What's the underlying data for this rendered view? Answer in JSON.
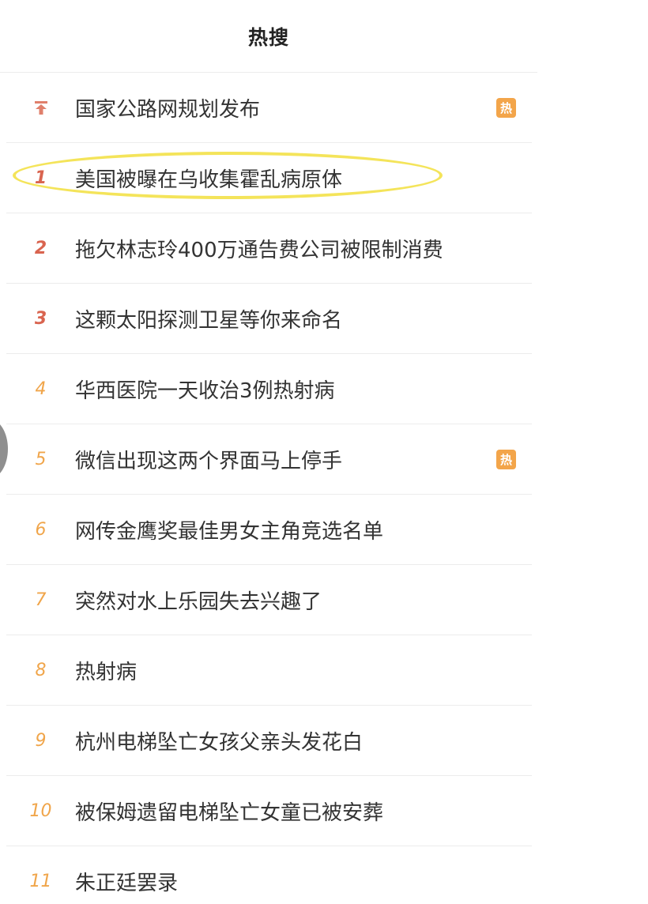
{
  "header": {
    "title": "热搜"
  },
  "pinned": {
    "text": "国家公路网规划发布",
    "badge": "热"
  },
  "items": [
    {
      "rank": "1",
      "text": "美国被曝在乌收集霍乱病原体",
      "badge": ""
    },
    {
      "rank": "2",
      "text": "拖欠林志玲400万通告费公司被限制消费",
      "badge": ""
    },
    {
      "rank": "3",
      "text": "这颗太阳探测卫星等你来命名",
      "badge": ""
    },
    {
      "rank": "4",
      "text": "华西医院一天收治3例热射病",
      "badge": ""
    },
    {
      "rank": "5",
      "text": "微信出现这两个界面马上停手",
      "badge": "热"
    },
    {
      "rank": "6",
      "text": "网传金鹰奖最佳男女主角竞选名单",
      "badge": ""
    },
    {
      "rank": "7",
      "text": "突然对水上乐园失去兴趣了",
      "badge": ""
    },
    {
      "rank": "8",
      "text": "热射病",
      "badge": ""
    },
    {
      "rank": "9",
      "text": "杭州电梯坠亡女孩父亲头发花白",
      "badge": ""
    },
    {
      "rank": "10",
      "text": "被保姆遗留电梯坠亡女童已被安葬",
      "badge": ""
    },
    {
      "rank": "11",
      "text": "朱正廷罢录",
      "badge": ""
    }
  ],
  "colors": {
    "top_rank": "#d9644f",
    "other_rank": "#f0a54a",
    "badge": "#f3a54a",
    "highlight": "#f4e45a"
  },
  "icons": {
    "pinned": "pin-top-icon"
  }
}
